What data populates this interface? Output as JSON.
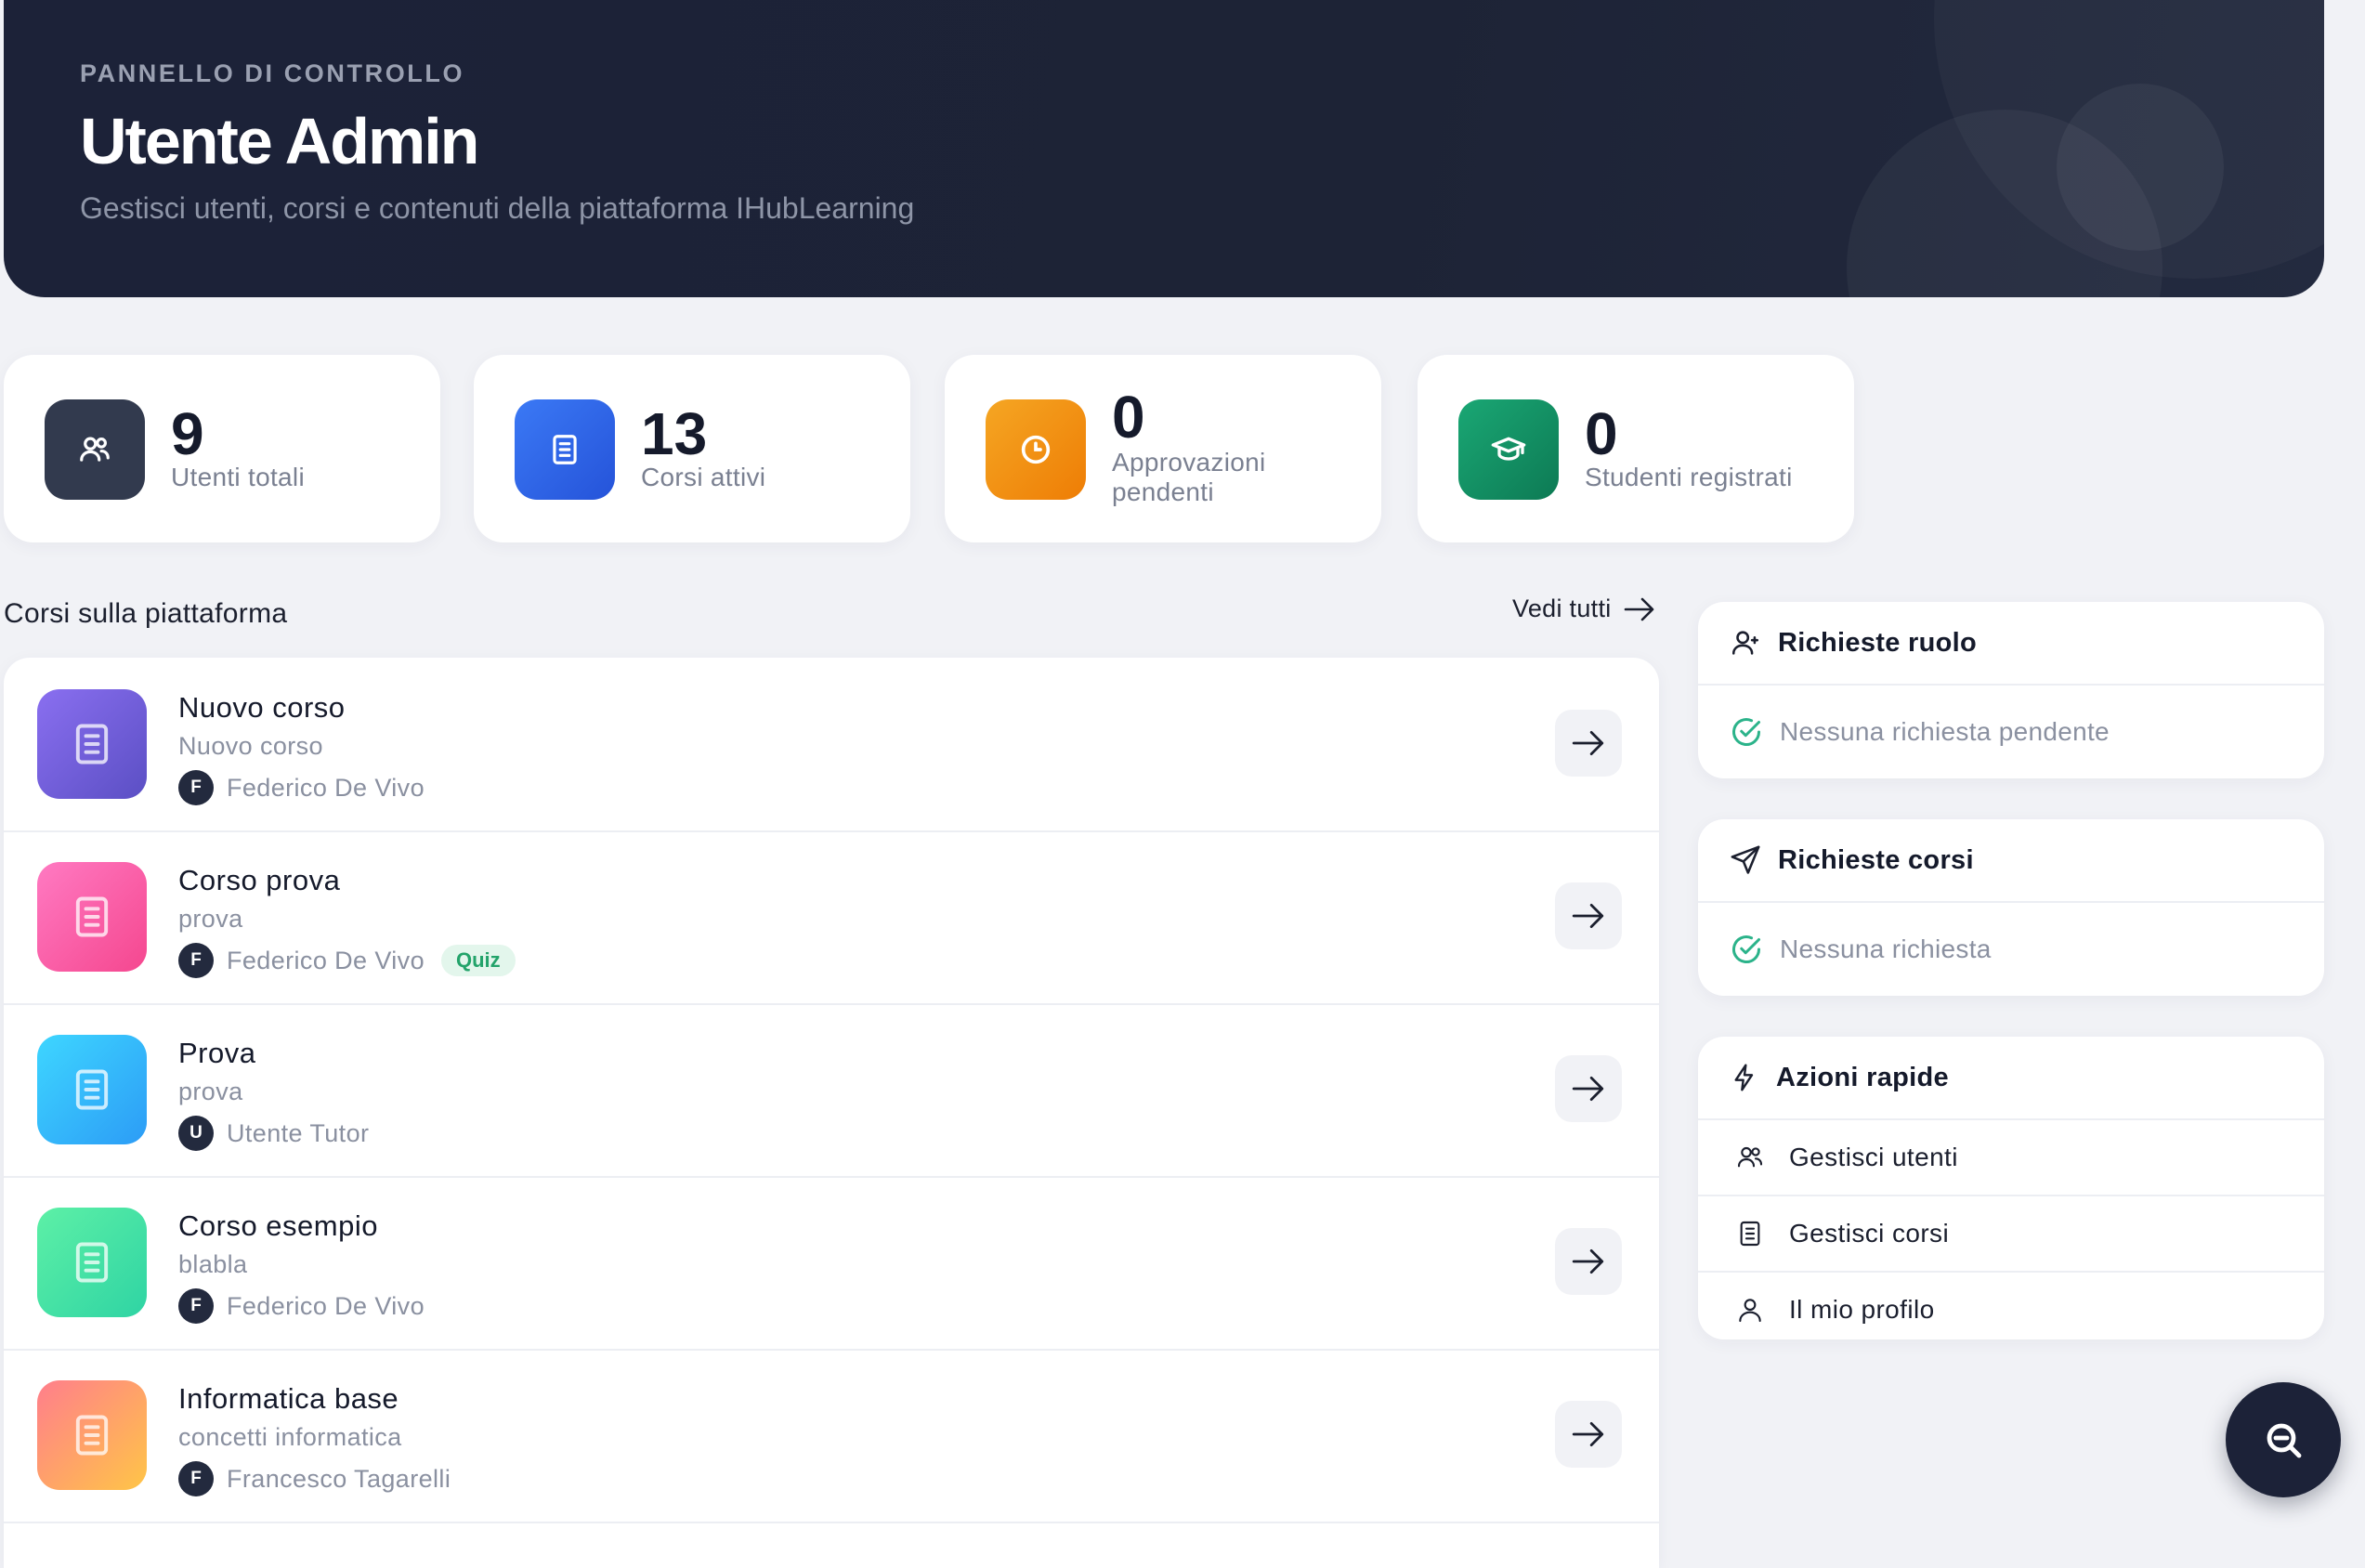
{
  "header": {
    "eyebrow": "PANNELLO DI CONTROLLO",
    "title": "Utente Admin",
    "subtitle": "Gestisci utenti, corsi e contenuti della piattaforma IHubLearning"
  },
  "stats": [
    {
      "value": "9",
      "label": "Utenti totali",
      "icon": "users-icon",
      "color": "#323a4e"
    },
    {
      "value": "13",
      "label": "Corsi attivi",
      "icon": "book-icon",
      "color": "#2f63e8"
    },
    {
      "value": "0",
      "label": "Approvazioni pendenti",
      "icon": "clock-icon",
      "color": "#f08c0a"
    },
    {
      "value": "0",
      "label": "Studenti registrati",
      "icon": "graduation-cap-icon",
      "color": "#128a5e"
    }
  ],
  "courses": {
    "title": "Corsi sulla piattaforma",
    "see_all": "Vedi tutti",
    "items": [
      {
        "title": "Nuovo corso",
        "subtitle": "Nuovo corso",
        "initial": "F",
        "author": "Federico De Vivo",
        "badge": "",
        "colors": [
          "#8a6ff0",
          "#5b4fc4"
        ]
      },
      {
        "title": "Corso prova",
        "subtitle": "prova",
        "initial": "F",
        "author": "Federico De Vivo",
        "badge": "Quiz",
        "colors": [
          "#ff7ac2",
          "#f5478f"
        ]
      },
      {
        "title": "Prova",
        "subtitle": "prova",
        "initial": "U",
        "author": "Utente Tutor",
        "badge": "",
        "colors": [
          "#3ed6ff",
          "#2c9cf6"
        ]
      },
      {
        "title": "Corso esempio",
        "subtitle": "blabla",
        "initial": "F",
        "author": "Federico De Vivo",
        "badge": "",
        "colors": [
          "#5df0a6",
          "#2fd4a4"
        ]
      },
      {
        "title": "Informatica base",
        "subtitle": "concetti informatica",
        "initial": "F",
        "author": "Francesco Tagarelli",
        "badge": "",
        "colors": [
          "#ff7e8c",
          "#ffc547"
        ]
      }
    ]
  },
  "role_requests": {
    "title": "Richieste ruolo",
    "empty": "Nessuna richiesta pendente"
  },
  "course_requests": {
    "title": "Richieste corsi",
    "empty": "Nessuna richiesta"
  },
  "quick_actions": {
    "title": "Azioni rapide",
    "items": [
      {
        "label": "Gestisci utenti",
        "icon": "users-icon"
      },
      {
        "label": "Gestisci corsi",
        "icon": "document-icon"
      },
      {
        "label": "Il mio profilo",
        "icon": "user-icon"
      }
    ]
  },
  "accent_success": "#2bb38a"
}
